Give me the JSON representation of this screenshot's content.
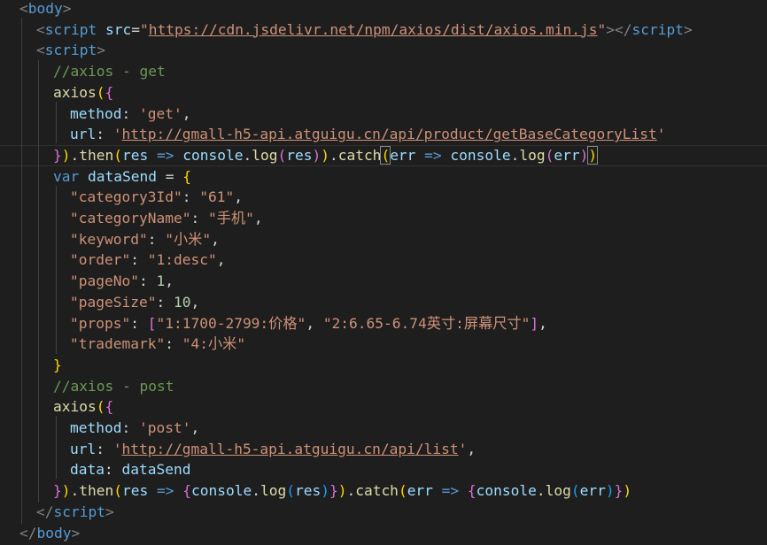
{
  "lines": [
    [
      "<",
      "body",
      ">"
    ],
    [
      "<",
      "script",
      " ",
      "src",
      "=",
      "\"",
      "https://cdn.jsdelivr.net/npm/axios/dist/axios.min.js",
      "\"",
      "></",
      "script",
      ">"
    ],
    [
      "<",
      "script",
      ">"
    ],
    [
      "//axios - get"
    ],
    [
      "axios",
      "(",
      "{"
    ],
    [
      "method",
      ": ",
      "'get'",
      ","
    ],
    [
      "url",
      ": ",
      "'",
      "http://gmall-h5-api.atguigu.cn/api/product/getBaseCategoryList",
      "'"
    ],
    [
      "}",
      ")",
      ".",
      "then",
      "(",
      "res",
      " => ",
      "console",
      ".",
      "log",
      "(",
      "res",
      ")",
      ")",
      ".",
      "catch",
      "(",
      "err",
      " => ",
      "console",
      ".",
      "log",
      "(",
      "err",
      ")",
      ")"
    ],
    [
      "var",
      " ",
      "dataSend",
      " = ",
      "{"
    ],
    [
      "\"category3Id\"",
      ": ",
      "\"61\"",
      ","
    ],
    [
      "\"categoryName\"",
      ": ",
      "\"手机\"",
      ","
    ],
    [
      "\"keyword\"",
      ": ",
      "\"小米\"",
      ","
    ],
    [
      "\"order\"",
      ": ",
      "\"1:desc\"",
      ","
    ],
    [
      "\"pageNo\"",
      ": ",
      "1",
      ","
    ],
    [
      "\"pageSize\"",
      ": ",
      "10",
      ","
    ],
    [
      "\"props\"",
      ": ",
      "[",
      "\"1:1700-2799:价格\"",
      ", ",
      "\"2:6.65-6.74英寸:屏幕尺寸\"",
      "]",
      ","
    ],
    [
      "\"trademark\"",
      ": ",
      "\"4:小米\""
    ],
    [
      "}"
    ],
    [
      "//axios - post"
    ],
    [
      "axios",
      "(",
      "{"
    ],
    [
      "method",
      ": ",
      "'post'",
      ","
    ],
    [
      "url",
      ": ",
      "'",
      "http://gmall-h5-api.atguigu.cn/api/list",
      "'",
      ","
    ],
    [
      "data",
      ": ",
      "dataSend"
    ],
    [
      "}",
      ")",
      ".",
      "then",
      "(",
      "res",
      " => ",
      "{",
      "console",
      ".",
      "log",
      "(",
      "res",
      ")",
      "}",
      ")",
      ".",
      "catch",
      "(",
      "err",
      " => ",
      "{",
      "console",
      ".",
      "log",
      "(",
      "err",
      ")",
      "}",
      ")"
    ],
    [
      "</",
      "script",
      ">"
    ],
    [
      "</",
      "body",
      ">"
    ]
  ]
}
